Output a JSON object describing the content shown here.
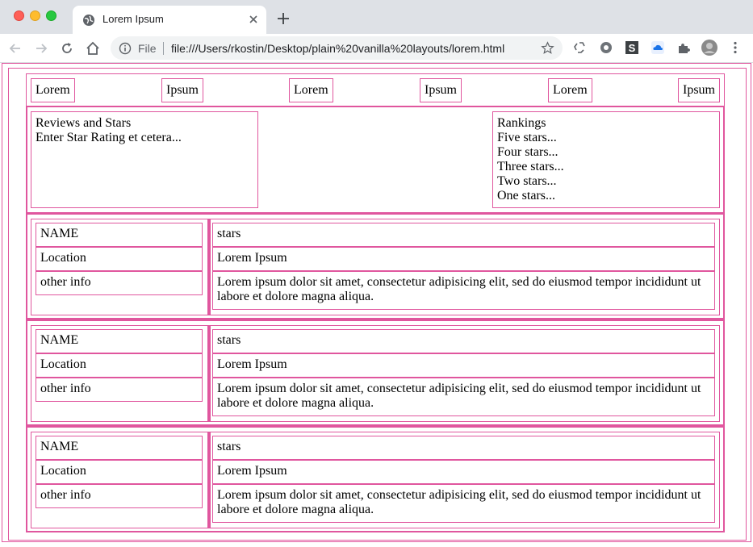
{
  "browser": {
    "tab_title": "Lorem Ipsum",
    "file_label": "File",
    "url": "file:///Users/rkostin/Desktop/plain%20vanilla%20layouts/lorem.html"
  },
  "nav": {
    "items": [
      {
        "label": "Lorem"
      },
      {
        "label": "Ipsum"
      },
      {
        "label": "Lorem"
      },
      {
        "label": "Ipsum"
      },
      {
        "label": "Lorem"
      },
      {
        "label": "Ipsum"
      }
    ]
  },
  "reviews": {
    "title": "Reviews and Stars",
    "subtitle": "Enter Star Rating et cetera..."
  },
  "rankings": {
    "title": "Rankings",
    "items": [
      "Five stars...",
      "Four stars...",
      "Three stars...",
      "Two stars...",
      "One stars..."
    ]
  },
  "cards": [
    {
      "name": "NAME",
      "location": "Location",
      "other": "other info",
      "stars": "stars",
      "place": "Lorem Ipsum",
      "text": "Lorem ipsum dolor sit amet, consectetur adipisicing elit, sed do eiusmod tempor incididunt ut labore et dolore magna aliqua."
    },
    {
      "name": "NAME",
      "location": "Location",
      "other": "other info",
      "stars": "stars",
      "place": "Lorem Ipsum",
      "text": "Lorem ipsum dolor sit amet, consectetur adipisicing elit, sed do eiusmod tempor incididunt ut labore et dolore magna aliqua."
    },
    {
      "name": "NAME",
      "location": "Location",
      "other": "other info",
      "stars": "stars",
      "place": "Lorem Ipsum",
      "text": "Lorem ipsum dolor sit amet, consectetur adipisicing elit, sed do eiusmod tempor incididunt ut labore et dolore magna aliqua."
    }
  ]
}
